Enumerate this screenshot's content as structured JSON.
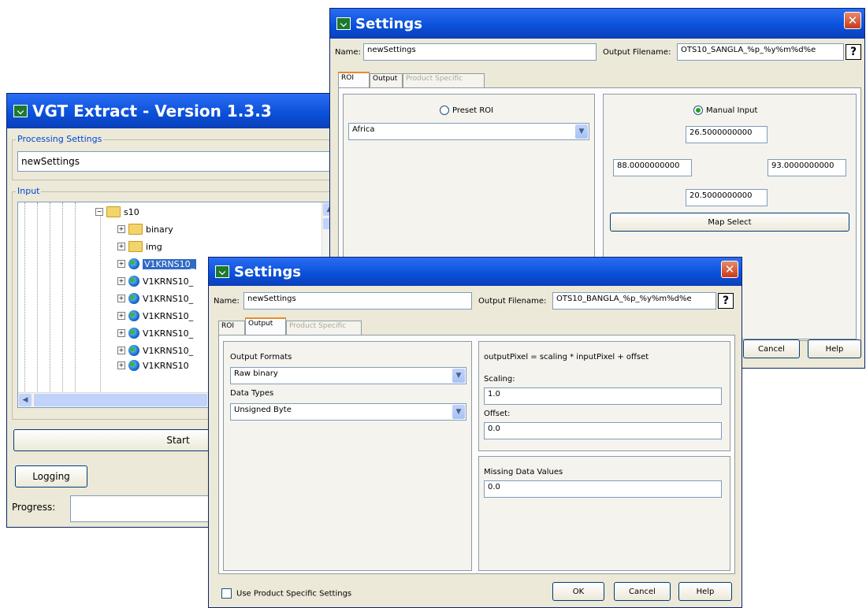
{
  "vgt": {
    "title": "VGT Extract - Version 1.3.3",
    "processing_legend": "Processing Settings",
    "processing_value": "newSettings",
    "input_legend": "Input",
    "tree": [
      {
        "label": "s10",
        "kind": "folder-open"
      },
      {
        "label": "binary",
        "kind": "folder"
      },
      {
        "label": "img",
        "kind": "folder"
      },
      {
        "label": "V1KRNS10_",
        "kind": "globe",
        "selected": true
      },
      {
        "label": "V1KRNS10_",
        "kind": "globe"
      },
      {
        "label": "V1KRNS10_",
        "kind": "globe"
      },
      {
        "label": "V1KRNS10_",
        "kind": "globe"
      },
      {
        "label": "V1KRNS10_",
        "kind": "globe"
      },
      {
        "label": "V1KRNS10_",
        "kind": "globe"
      },
      {
        "label": "V1KRNS10",
        "kind": "globe"
      }
    ],
    "start_label": "Start",
    "logging_label": "Logging",
    "progress_label": "Progress:"
  },
  "settings_back": {
    "title": "Settings",
    "name_label": "Name:",
    "name_value": "newSettings",
    "output_label": "Output Filename:",
    "output_value": "OTS10_SANGLA_%p_%y%m%d%e",
    "help_glyph": "?",
    "tabs": [
      "ROI",
      "Output",
      "Product Specific"
    ],
    "preset_label": "Preset ROI",
    "preset_value": "Africa",
    "manual_label": "Manual Input",
    "north": "26.5000000000",
    "west": "88.0000000000",
    "east": "93.0000000000",
    "south": "20.5000000000",
    "map_select": "Map Select",
    "cancel": "Cancel",
    "help": "Help"
  },
  "settings_front": {
    "title": "Settings",
    "name_label": "Name:",
    "name_value": "newSettings",
    "output_label": "Output Filename:",
    "output_value": "OTS10_BANGLA_%p_%y%m%d%e",
    "help_glyph": "?",
    "tabs": [
      "ROI",
      "Output",
      "Product Specific"
    ],
    "output_formats_label": "Output Formats",
    "output_formats_value": "Raw binary",
    "data_types_label": "Data Types",
    "data_types_value": "Unsigned Byte",
    "formula": "outputPixel = scaling * inputPixel + offset",
    "scaling_label": "Scaling:",
    "scaling_value": "1.0",
    "offset_label": "Offset:",
    "offset_value": "0.0",
    "missing_label": "Missing Data Values",
    "missing_value": "0.0",
    "use_product_label": "Use Product Specific Settings",
    "ok": "OK",
    "cancel": "Cancel",
    "help": "Help"
  },
  "icons": {
    "close": "close-icon",
    "app": "app-icon",
    "dropdown": "chevron-down-icon"
  }
}
